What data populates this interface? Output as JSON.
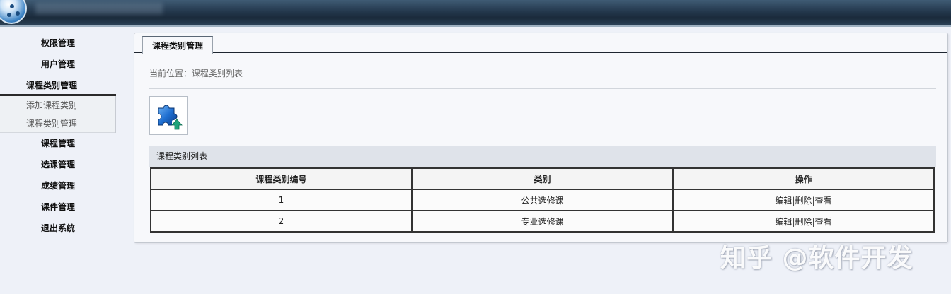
{
  "header": {
    "logo_icon": "globe-logo-icon"
  },
  "sidebar": {
    "items": [
      {
        "label": "权限管理"
      },
      {
        "label": "用户管理"
      },
      {
        "label": "课程类别管理"
      },
      {
        "label": "课程管理"
      },
      {
        "label": "选课管理"
      },
      {
        "label": "成绩管理"
      },
      {
        "label": "课件管理"
      },
      {
        "label": "退出系统"
      }
    ],
    "submenu": [
      {
        "label": "添加课程类别"
      },
      {
        "label": "课程类别管理"
      }
    ]
  },
  "main": {
    "tab_label": "课程类别管理",
    "breadcrumb": "当前位置：课程类别列表",
    "add_icon": "puzzle-upload-icon",
    "section_title": "课程类别列表",
    "table": {
      "headers": [
        "课程类别编号",
        "类别",
        "操作"
      ],
      "rows": [
        {
          "id": "1",
          "category": "公共选修课",
          "edit": "编辑",
          "delete": "删除",
          "view": "查看"
        },
        {
          "id": "2",
          "category": "专业选修课",
          "edit": "编辑",
          "delete": "删除",
          "view": "查看"
        }
      ],
      "separator": "|"
    }
  },
  "watermark": "知乎 @软件开发",
  "colors": {
    "header": "#24384d",
    "background": "#eef1f8",
    "table_border": "#333333"
  }
}
